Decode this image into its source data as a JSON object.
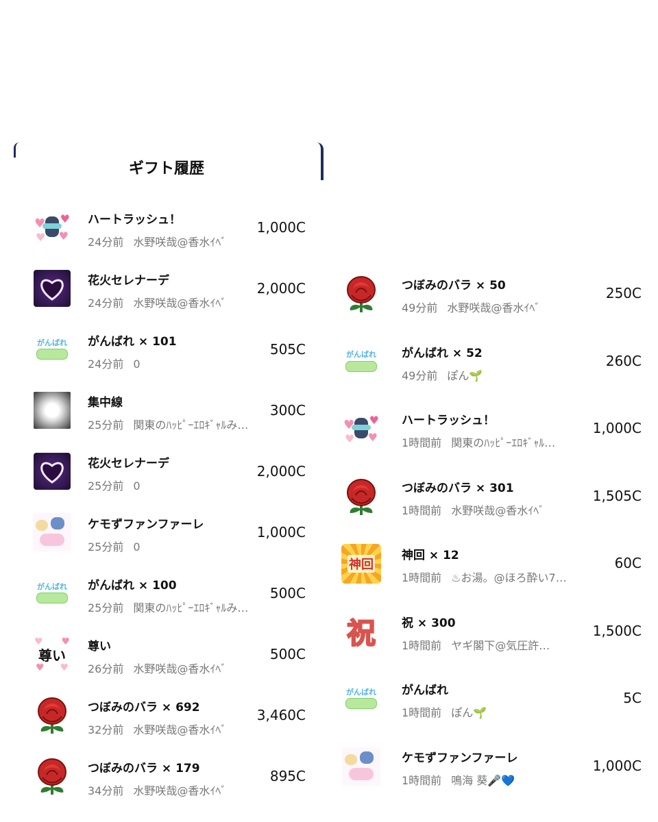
{
  "header": {
    "title": "ギフト履歴"
  },
  "left_list": [
    {
      "icon": "heart-rush-icon",
      "name": "ハートラッシュ！",
      "time": "24分前",
      "user": "水野咲哉@香水ｲﾍﾞ",
      "price": "1,000C"
    },
    {
      "icon": "fireworks-heart-icon",
      "name": "花火セレナーデ",
      "time": "24分前",
      "user": "水野咲哉@香水ｲﾍﾞ",
      "price": "2,000C"
    },
    {
      "icon": "ganbare-icon",
      "name": "がんばれ × 101",
      "time": "24分前",
      "user": "0",
      "price": "505C"
    },
    {
      "icon": "focus-lines-icon",
      "name": "集中線",
      "time": "25分前",
      "user": "関東のﾊｯﾋﾟｰｴﾛｷﾞｬﾙみ…",
      "price": "300C"
    },
    {
      "icon": "fireworks-heart-icon",
      "name": "花火セレナーデ",
      "time": "25分前",
      "user": "0",
      "price": "2,000C"
    },
    {
      "icon": "kemozu-fanfare-icon",
      "name": "ケモずファンファーレ",
      "time": "25分前",
      "user": "0",
      "price": "1,000C"
    },
    {
      "icon": "ganbare-icon",
      "name": "がんばれ × 100",
      "time": "25分前",
      "user": "関東のﾊｯﾋﾟｰｴﾛｷﾞｬﾙみ…",
      "price": "500C"
    },
    {
      "icon": "toutoi-icon",
      "name": "尊い",
      "time": "26分前",
      "user": "水野咲哉@香水ｲﾍﾞ",
      "price": "500C"
    },
    {
      "icon": "rose-icon",
      "name": "つぼみのバラ × 692",
      "time": "32分前",
      "user": "水野咲哉@香水ｲﾍﾞ",
      "price": "3,460C"
    },
    {
      "icon": "rose-icon",
      "name": "つぼみのバラ × 179",
      "time": "34分前",
      "user": "水野咲哉@香水ｲﾍﾞ",
      "price": "895C"
    }
  ],
  "right_list": [
    {
      "icon": "rose-icon",
      "name": "つぼみのバラ × 50",
      "time": "49分前",
      "user": "水野咲哉@香水ｲﾍﾞ",
      "price": "250C"
    },
    {
      "icon": "ganbare-icon",
      "name": "がんばれ × 52",
      "time": "49分前",
      "user": "ぽん🌱",
      "price": "260C"
    },
    {
      "icon": "heart-rush-icon",
      "name": "ハートラッシュ！",
      "time": "1時間前",
      "user": "関東のﾊｯﾋﾟｰｴﾛｷﾞｬﾙ…",
      "price": "1,000C"
    },
    {
      "icon": "rose-icon",
      "name": "つぼみのバラ × 301",
      "time": "1時間前",
      "user": "水野咲哉@香水ｲﾍﾞ",
      "price": "1,505C"
    },
    {
      "icon": "kamikai-icon",
      "name": "神回 × 12",
      "time": "1時間前",
      "user": "♨お湯。@ほろ酔い7…",
      "price": "60C"
    },
    {
      "icon": "iwai-icon",
      "name": "祝 × 300",
      "time": "1時間前",
      "user": "ヤギ閣下@気圧許…",
      "price": "1,500C"
    },
    {
      "icon": "ganbare-icon",
      "name": "がんばれ",
      "time": "1時間前",
      "user": "ぽん🌱",
      "price": "5C"
    },
    {
      "icon": "kemozu-fanfare-icon",
      "name": "ケモずファンファーレ",
      "time": "1時間前",
      "user": "鳴海 葵🎤💙",
      "price": "1,000C"
    }
  ],
  "icon_text": {
    "kamikai": "神回",
    "ganbare": "がんばれ",
    "toutoi": "尊い",
    "iwai": "祝"
  },
  "colors": {
    "rose": "#c62828",
    "leaf": "#2e7d32",
    "navy": "#1f2d5a",
    "meta": "#777777"
  }
}
